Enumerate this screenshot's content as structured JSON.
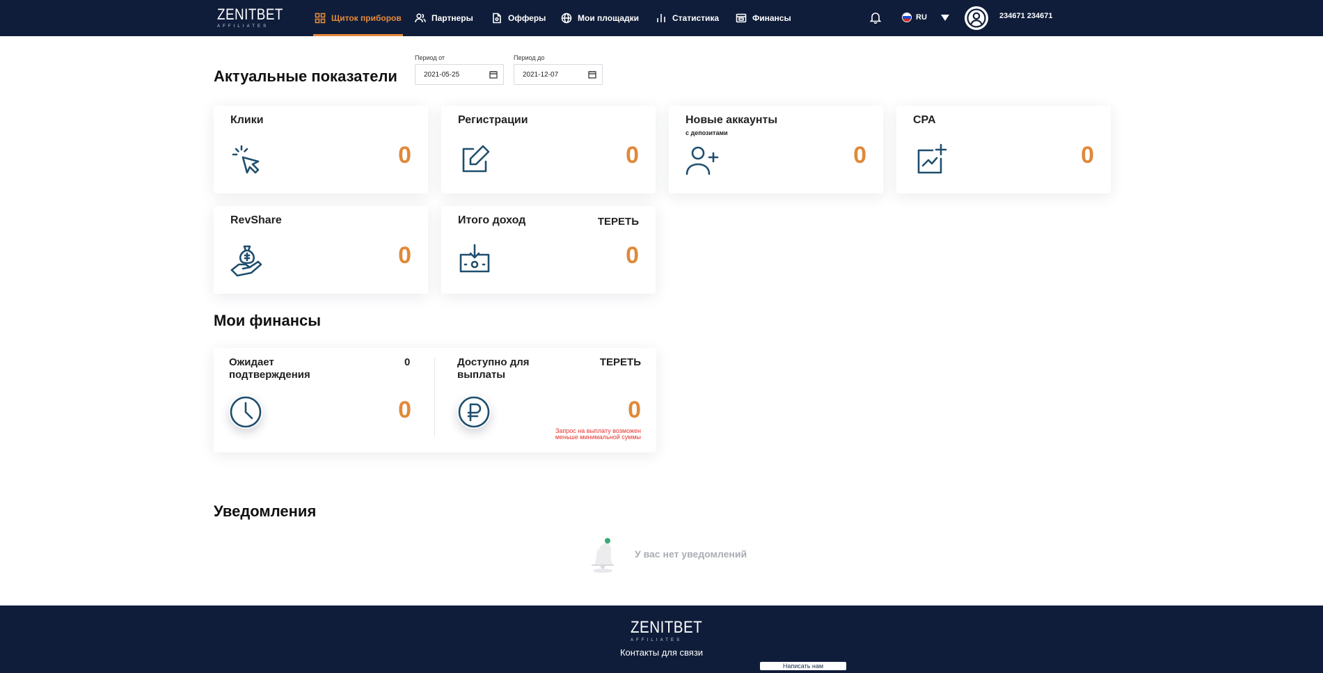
{
  "header": {
    "logo_main": "ZENITBET",
    "logo_sub": "AFFILIATES",
    "nav": [
      {
        "label": "Щиток приборов",
        "icon": "dashboard-icon",
        "active": true
      },
      {
        "label": "Партнеры",
        "icon": "users-icon",
        "active": false
      },
      {
        "label": "Офферы",
        "icon": "document-icon",
        "active": false
      },
      {
        "label": "Мои площадки",
        "icon": "globe-icon",
        "active": false
      },
      {
        "label": "Статистика",
        "icon": "bar-chart-icon",
        "active": false
      },
      {
        "label": "Финансы",
        "icon": "wallet-icon",
        "active": false
      }
    ],
    "language": "RU",
    "username": "234671 234671"
  },
  "indicators": {
    "title": "Актуальные показатели",
    "period_from_label": "Период от",
    "period_from_value": "2021-05-25",
    "period_to_label": "Период до",
    "period_to_value": "2021-12-07",
    "cards": [
      {
        "title": "Клики",
        "value": "0",
        "icon": "cursor-click-icon"
      },
      {
        "title": "Регистрации",
        "value": "0",
        "icon": "edit-icon"
      },
      {
        "title": "Новые аккаунты",
        "subtitle": "с депозитами",
        "value": "0",
        "icon": "user-plus-icon"
      },
      {
        "title": "CPA",
        "value": "0",
        "icon": "chart-add-icon"
      },
      {
        "title": "RevShare",
        "value": "0",
        "icon": "money-hand-icon"
      },
      {
        "title": "Итого доход",
        "currency": "ТЕРЕТЬ",
        "value": "0",
        "icon": "cash-download-icon"
      }
    ]
  },
  "finances": {
    "title": "Мои финансы",
    "pending_label": "Ожидает подтверждения",
    "pending_small": "0",
    "pending_value": "0",
    "available_label": "Доступно для выплаты",
    "available_currency": "ТЕРЕТЬ",
    "available_value": "0",
    "payout_warning": "Запрос на выплату возможен меньше минимальной суммы"
  },
  "notifications": {
    "title": "Уведомления",
    "empty_text": "У вас нет уведомлений"
  },
  "footer": {
    "logo_main": "ZENITBET",
    "logo_sub": "AFFILIATES",
    "contacts_label": "Контакты для связи",
    "write_us_label": "Написать нам"
  },
  "colors": {
    "header_bg": "#0f1d3a",
    "accent": "#e0893a",
    "icon": "#1f4e6e",
    "warning": "#e8332e"
  }
}
